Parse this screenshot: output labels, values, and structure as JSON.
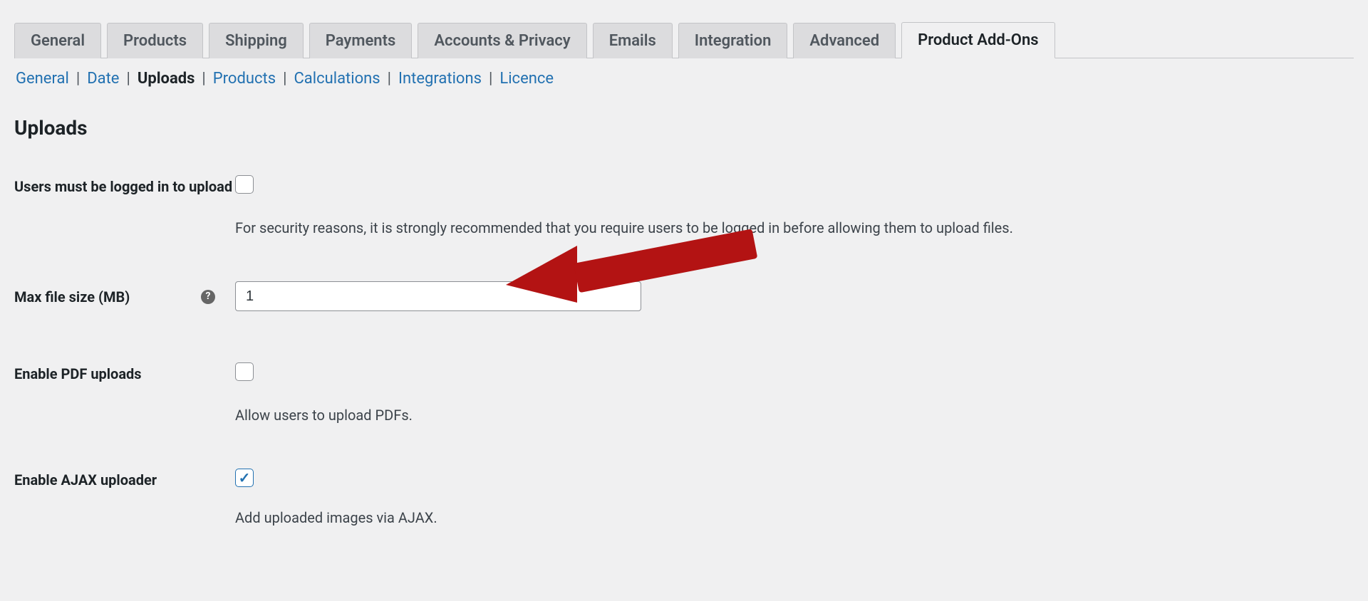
{
  "tabs": {
    "items": [
      {
        "label": "General",
        "active": false
      },
      {
        "label": "Products",
        "active": false
      },
      {
        "label": "Shipping",
        "active": false
      },
      {
        "label": "Payments",
        "active": false
      },
      {
        "label": "Accounts & Privacy",
        "active": false
      },
      {
        "label": "Emails",
        "active": false
      },
      {
        "label": "Integration",
        "active": false
      },
      {
        "label": "Advanced",
        "active": false
      },
      {
        "label": "Product Add-Ons",
        "active": true
      }
    ]
  },
  "subtabs": {
    "items": [
      {
        "label": "General",
        "active": false
      },
      {
        "label": "Date",
        "active": false
      },
      {
        "label": "Uploads",
        "active": true
      },
      {
        "label": "Products",
        "active": false
      },
      {
        "label": "Calculations",
        "active": false
      },
      {
        "label": "Integrations",
        "active": false
      },
      {
        "label": "Licence",
        "active": false
      }
    ]
  },
  "section": {
    "title": "Uploads"
  },
  "fields": {
    "logged_in": {
      "label": "Users must be logged in to upload",
      "checked": false,
      "desc": "For security reasons, it is strongly recommended that you require users to be logged in before allowing them to upload files."
    },
    "max_size": {
      "label": "Max file size (MB)",
      "value": "1",
      "help": "?"
    },
    "enable_pdf": {
      "label": "Enable PDF uploads",
      "checked": false,
      "desc": "Allow users to upload PDFs."
    },
    "enable_ajax": {
      "label": "Enable AJAX uploader",
      "checked": true,
      "desc": "Add uploaded images via AJAX."
    }
  }
}
